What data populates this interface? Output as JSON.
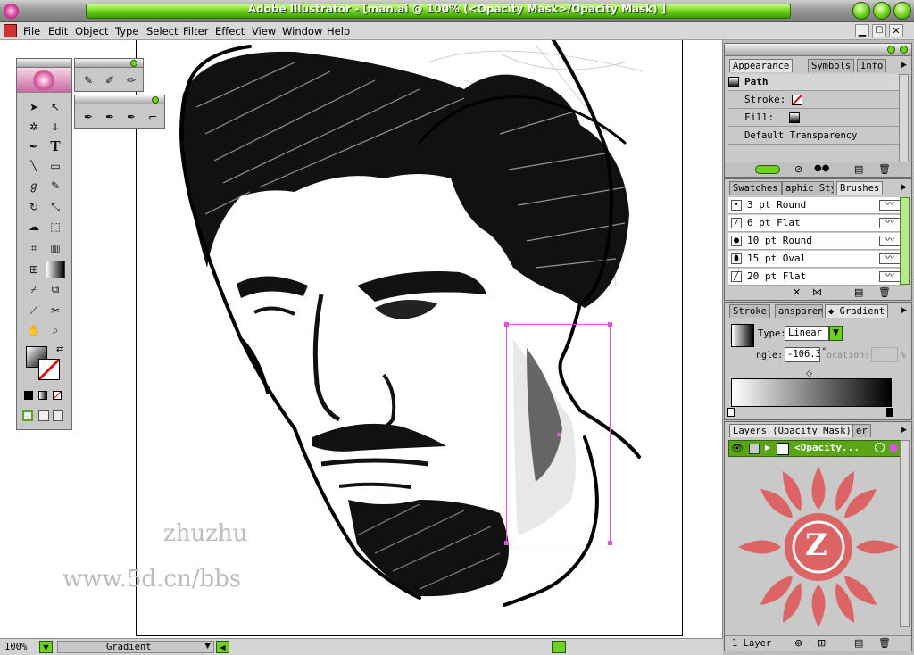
{
  "window": {
    "app_icon": "illustrator-flower-icon",
    "title": "Adobe Illustrator - [man.ai @ 100% (<Opacity Mask>/Opacity Mask) ]"
  },
  "menu": {
    "items": [
      "File",
      "Edit",
      "Object",
      "Type",
      "Select",
      "Filter",
      "Effect",
      "View",
      "Window",
      "Help"
    ]
  },
  "document": {
    "watermark_name": "zhuzhu",
    "watermark_url": "www.5d.cn/bbs"
  },
  "status": {
    "zoom": "100%",
    "tool_label": "Gradient"
  },
  "appearance_panel": {
    "tabs": [
      "Appearance",
      "Symbols",
      "Info"
    ],
    "object_type": "Path",
    "stroke_label": "Stroke:",
    "fill_label": "Fill:",
    "transparency": "Default Transparency"
  },
  "brushes_panel": {
    "tabs": [
      "Swatches",
      "aphic Sty",
      "Brushes"
    ],
    "items": [
      "3 pt Round",
      "6 pt Flat",
      "10 pt Round",
      "15 pt Oval",
      "20 pt Flat"
    ]
  },
  "gradient_panel": {
    "tabs": [
      "Stroke",
      "ansparen",
      "Gradient"
    ],
    "type_label": "Type:",
    "type_value": "Linear",
    "angle_label": "ngle:",
    "angle_value": "-106.3",
    "location_label": "ocation:",
    "location_unit": "%"
  },
  "layers_panel": {
    "tabs": [
      "Layers (Opacity Mask)",
      "er"
    ],
    "layer_name": "<Opacity...",
    "footer": "1 Layer",
    "logo_letter": "Z"
  },
  "colors": {
    "title_green": "#6ed21e",
    "selection": "#e052e0",
    "layer_green": "#5aa516",
    "logo_red": "#e05a5a"
  }
}
